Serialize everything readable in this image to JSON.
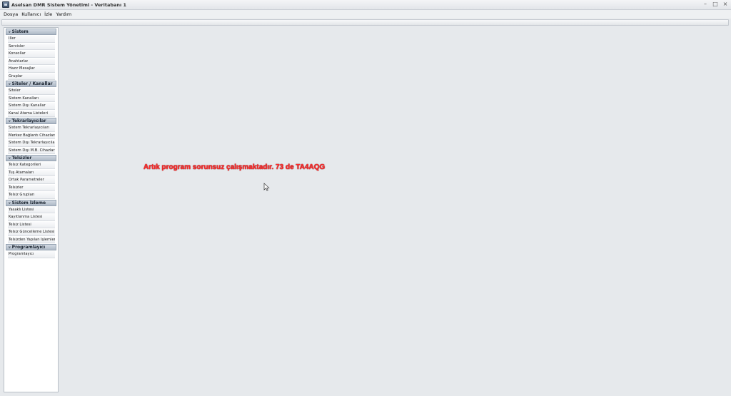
{
  "window": {
    "title": "Aselsan DMR Sistem Yönetimi - Veritabanı 1",
    "minimize": "–",
    "maximize": "□",
    "close": "×"
  },
  "menu": {
    "items": [
      "Dosya",
      "Kullanıcı",
      "İzle",
      "Yardım"
    ]
  },
  "sidebar": {
    "sections": [
      {
        "title": "Sistem",
        "items": [
          "İller",
          "Servisler",
          "Konsollar",
          "Anahtarlar",
          "Hazır Mesajlar",
          "Gruplar"
        ]
      },
      {
        "title": "Siteler / Kanallar",
        "items": [
          "Siteler",
          "Sistem Kanalları",
          "Sistem Dışı Kanallar",
          "Kanal Atama Listeleri"
        ]
      },
      {
        "title": "Tekrarlayıcılar",
        "items": [
          "Sistem Tekrarlayıcıları",
          "Merkez Bağlantı Cihazları",
          "Sistem Dışı Tekrarlayıcılar",
          "Sistem Dışı M.B. Cihazları"
        ]
      },
      {
        "title": "Telsizler",
        "items": [
          "Telsiz Kategorileri",
          "Tuş Atamaları",
          "Ortak Parametreler",
          "Telsizler",
          "Telsiz Grupları"
        ]
      },
      {
        "title": "Sistem İzleme",
        "items": [
          "Yasaklı Listesi",
          "Kayıtlanma Listesi",
          "Telsiz Listesi",
          "Telsiz Güncelleme Listesi",
          "Telsizden Yapılan İşlemler"
        ]
      },
      {
        "title": "Programlayıcı",
        "items": [
          "Programlayıcı"
        ]
      }
    ]
  },
  "main": {
    "message": "Artık program sorunsuz çalışmaktadır. 73 de TA4AQG",
    "message_color": "#ff2a2a"
  }
}
